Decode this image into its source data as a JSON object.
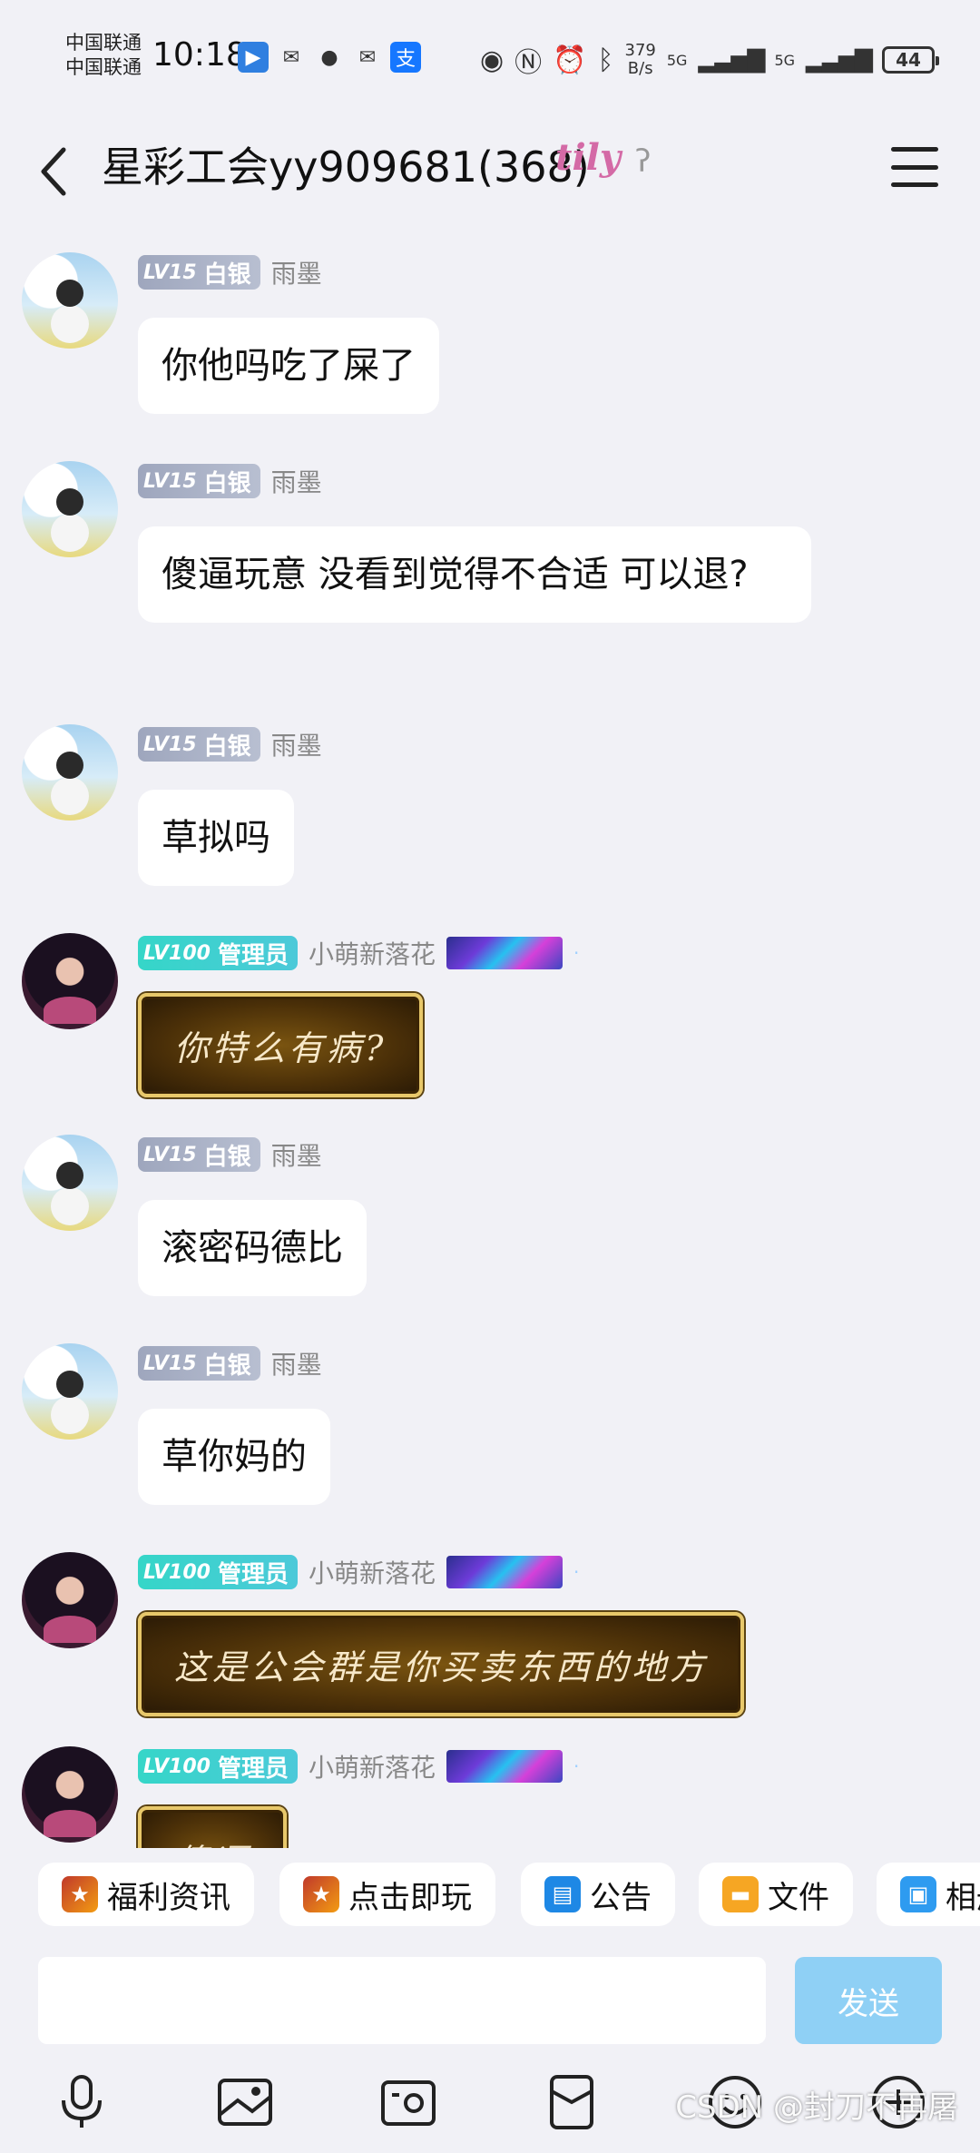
{
  "status_bar": {
    "carrier_1": "中国联通",
    "carrier_2": "中国联通",
    "time": "10:18",
    "net_speed_value": "379",
    "net_speed_unit": "B/s",
    "signal_1": "5G",
    "signal_2": "5G",
    "battery": "44"
  },
  "header": {
    "title": "星彩工会yy909681(368)",
    "title_tag": "tily"
  },
  "messages": [
    {
      "badge_level": "LV15",
      "badge_role": "白银",
      "sender": "雨墨",
      "text": "你他吗吃了屎了",
      "style": "plain"
    },
    {
      "badge_level": "LV15",
      "badge_role": "白银",
      "sender": "雨墨",
      "text": "傻逼玩意  没看到觉得不合适 可以退?",
      "style": "plain"
    },
    {
      "badge_level": "LV15",
      "badge_role": "白银",
      "sender": "雨墨",
      "text": "草拟吗",
      "style": "plain"
    },
    {
      "badge_level": "LV100",
      "badge_role": "管理员",
      "sender": "小萌新落花",
      "text": "你特么有病?",
      "style": "gold"
    },
    {
      "badge_level": "LV15",
      "badge_role": "白银",
      "sender": "雨墨",
      "text": "滚密码德比",
      "style": "plain"
    },
    {
      "badge_level": "LV15",
      "badge_role": "白银",
      "sender": "雨墨",
      "text": "草你妈的",
      "style": "plain"
    },
    {
      "badge_level": "LV100",
      "badge_role": "管理员",
      "sender": "小萌新落花",
      "text": "这是公会群是你买卖东西的地方",
      "style": "gold"
    },
    {
      "badge_level": "LV100",
      "badge_role": "管理员",
      "sender": "小萌新落花",
      "text": "傻逼",
      "style": "gold"
    }
  ],
  "quick_bar": [
    {
      "label": "福利资讯",
      "icon": "game-icon"
    },
    {
      "label": "点击即玩",
      "icon": "game-icon"
    },
    {
      "label": "公告",
      "icon": "announcement-icon"
    },
    {
      "label": "文件",
      "icon": "folder-icon"
    },
    {
      "label": "相册",
      "icon": "album-icon"
    }
  ],
  "input": {
    "value": "",
    "placeholder": ""
  },
  "send_label": "发送",
  "toolbar": [
    "microphone-icon",
    "image-icon",
    "camera-icon",
    "red-packet-icon",
    "emoji-icon",
    "plus-icon"
  ],
  "watermark": "CSDN @封刀不再屠",
  "colors": {
    "background": "#f1f1f6",
    "silver_badge": "#a9b0c6",
    "admin_badge": "#3fd2cf",
    "send_button": "#8fd0f5"
  }
}
